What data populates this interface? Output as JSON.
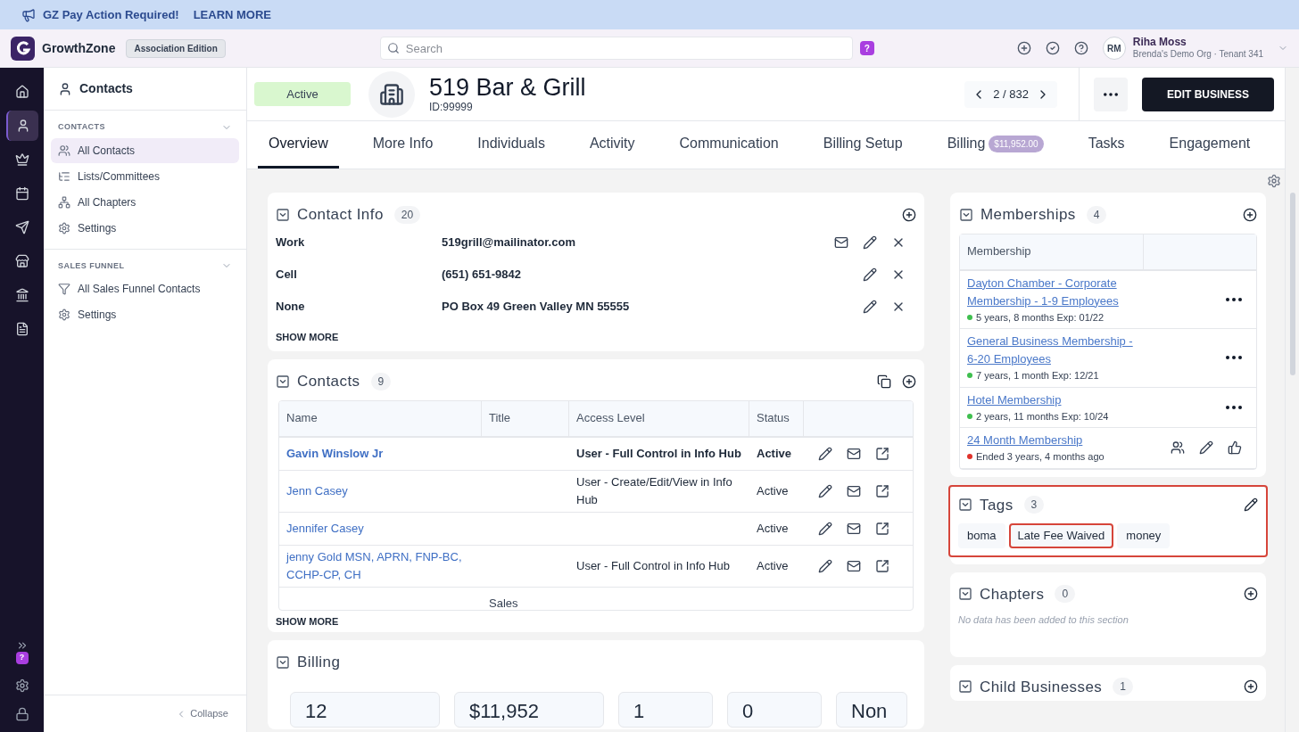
{
  "banner": {
    "text": "GZ Pay Action Required!",
    "link": "LEARN MORE"
  },
  "topbar": {
    "brand": "GrowthZone",
    "edition": "Association Edition",
    "search_placeholder": "Search",
    "help_badge": "?",
    "user": {
      "initials": "RM",
      "name": "Riha Moss",
      "org": "Brenda's Demo Org · Tenant 341"
    }
  },
  "rail": {
    "items": [
      {
        "kind": "home",
        "selected": false
      },
      {
        "kind": "contacts",
        "selected": true
      },
      {
        "kind": "crown",
        "selected": false
      },
      {
        "kind": "calendar",
        "selected": false
      },
      {
        "kind": "send",
        "selected": false
      },
      {
        "kind": "store",
        "selected": false
      },
      {
        "kind": "bank",
        "selected": false
      },
      {
        "kind": "report",
        "selected": false
      }
    ],
    "badge": "?"
  },
  "sidebar": {
    "title": "Contacts",
    "sections": [
      {
        "heading": "CONTACTS",
        "items": [
          {
            "label": "All Contacts",
            "selected": true
          },
          {
            "label": "Lists/Committees",
            "selected": false
          },
          {
            "label": "All Chapters",
            "selected": false
          },
          {
            "label": "Settings",
            "selected": false
          }
        ]
      },
      {
        "heading": "SALES FUNNEL",
        "items": [
          {
            "label": "All Sales Funnel Contacts",
            "selected": false
          },
          {
            "label": "Settings",
            "selected": false
          }
        ]
      }
    ],
    "collapse": "Collapse"
  },
  "record": {
    "status": "Active",
    "name": "519 Bar & Grill",
    "id": "ID:99999",
    "position": "2 / 832",
    "edit_button": "EDIT BUSINESS"
  },
  "tabs": [
    {
      "label": "Overview",
      "selected": true
    },
    {
      "label": "More Info",
      "selected": false
    },
    {
      "label": "Individuals",
      "selected": false
    },
    {
      "label": "Activity",
      "selected": false
    },
    {
      "label": "Communication",
      "selected": false
    },
    {
      "label": "Billing Setup",
      "selected": false
    },
    {
      "label": "Billing",
      "badge": "$11,952.00",
      "selected": false
    },
    {
      "label": "Tasks",
      "selected": false
    },
    {
      "label": "Engagement",
      "selected": false
    }
  ],
  "contact_info": {
    "title": "Contact Info",
    "count": "20",
    "rows": [
      {
        "label": "Work",
        "value": "519grill@mailinator.com",
        "email": true
      },
      {
        "label": "Cell",
        "value": "(651) 651-9842",
        "email": false
      },
      {
        "label": "None",
        "value": "PO Box 49 Green Valley MN 55555",
        "email": false
      }
    ],
    "show_more": "SHOW MORE"
  },
  "contacts": {
    "title": "Contacts",
    "count": "9",
    "columns": [
      "Name",
      "Title",
      "Access Level",
      "Status"
    ],
    "rows": [
      {
        "name": "Gavin Winslow Jr",
        "title": "",
        "access": "User - Full Control in Info Hub",
        "status": "Active",
        "primary": true
      },
      {
        "name": "Jenn Casey",
        "title": "",
        "access": "User - Create/Edit/View in Info Hub",
        "status": "Active",
        "primary": false
      },
      {
        "name": "Jennifer Casey",
        "title": "",
        "access": "",
        "status": "Active",
        "primary": false
      },
      {
        "name": "jenny Gold MSN, APRN, FNP-BC, CCHP-CP, CH",
        "title": "",
        "access": "User - Full Control in Info Hub",
        "status": "Active",
        "primary": false
      },
      {
        "name": "",
        "title": "Sales",
        "access": "",
        "status": "",
        "primary": false
      }
    ],
    "show_more": "SHOW MORE"
  },
  "billing": {
    "title": "Billing",
    "stats": [
      "12",
      "$11,952",
      "1",
      "0",
      "Non"
    ]
  },
  "memberships": {
    "title": "Memberships",
    "count": "4",
    "column": "Membership",
    "rows": [
      {
        "name": "Dayton Chamber - Corporate Membership - 1-9 Employees",
        "detail": "5 years, 8 months Exp: 01/22",
        "color": "#3fbf4f",
        "kind": "menu"
      },
      {
        "name": "General Business Membership - 6-20 Employees",
        "detail": "7 years, 1 month Exp: 12/21",
        "color": "#3fbf4f",
        "kind": "menu"
      },
      {
        "name": "Hotel Membership",
        "detail": "2 years, 11 months Exp: 10/24",
        "color": "#3fbf4f",
        "kind": "menu"
      },
      {
        "name": "24 Month Membership",
        "detail": "Ended 3 years, 4 months ago",
        "color": "#e0322b",
        "kind": "actions"
      }
    ]
  },
  "tags": {
    "title": "Tags",
    "count": "3",
    "highlighted": true,
    "items": [
      {
        "label": "boma",
        "highlighted": false
      },
      {
        "label": "Late Fee Waived",
        "highlighted": true
      },
      {
        "label": "money",
        "highlighted": false
      }
    ]
  },
  "chapters": {
    "title": "Chapters",
    "count": "0",
    "empty": "No data has been added to this section"
  },
  "child_businesses": {
    "title": "Child Businesses",
    "count": "1"
  }
}
